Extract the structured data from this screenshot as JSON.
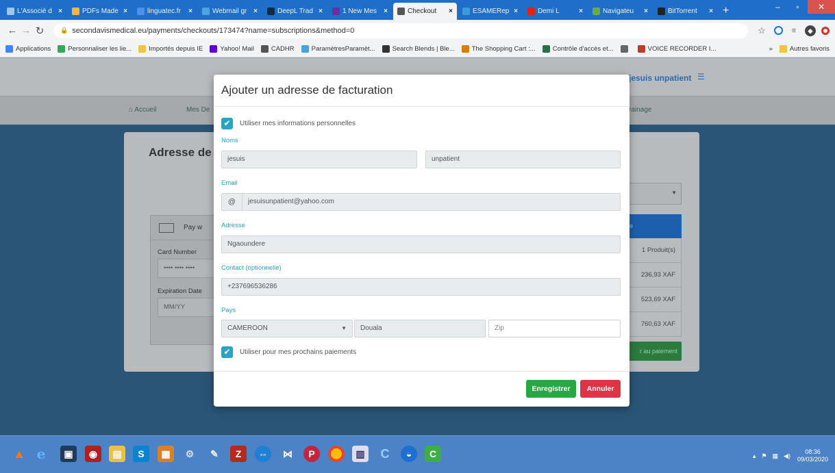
{
  "browser": {
    "tabs": [
      {
        "title": "L'Associé d",
        "color": "#9ec4ef"
      },
      {
        "title": "PDFs Made",
        "color": "#f0b44c"
      },
      {
        "title": "linguatec.fr",
        "color": "#4f8fe8"
      },
      {
        "title": "Webmail gr",
        "color": "#4fa3e0"
      },
      {
        "title": "DeepL Trad",
        "color": "#0f2b46"
      },
      {
        "title": "1 New Mes",
        "color": "#6d2fa0"
      },
      {
        "title": "Checkout",
        "color": "#555555",
        "active": true
      },
      {
        "title": "ESAMERep",
        "color": "#3e9bd6"
      },
      {
        "title": "Demi L",
        "color": "#e0241b"
      },
      {
        "title": "Navigateu",
        "color": "#6aa84f"
      },
      {
        "title": "BitTorrent",
        "color": "#222222"
      }
    ],
    "new_tab": "+",
    "url": "secondavismedical.eu/payments/checkouts/173474?name=subscriptions&method=0",
    "bookmarks": [
      {
        "label": "Applications",
        "color": "#4285f4"
      },
      {
        "label": "Personnaliser les lie...",
        "color": "#34a853"
      },
      {
        "label": "Importés depuis IE",
        "color": "#f4c542"
      },
      {
        "label": "Yahoo! Mail",
        "color": "#6001d2"
      },
      {
        "label": "CADHR",
        "color": "#555555"
      },
      {
        "label": "ParamètresParamèt...",
        "color": "#4aa3df"
      },
      {
        "label": "Search Blends | Ble...",
        "color": "#333333"
      },
      {
        "label": "The Shopping Cart :...",
        "color": "#e07b00"
      },
      {
        "label": "Contrôle d'accès et...",
        "color": "#2c6e49"
      },
      {
        "label": "",
        "color": "#666666"
      },
      {
        "label": "VOICE RECORDER I...",
        "color": "#c0392b"
      }
    ],
    "other_bookmarks": "Autres favoris",
    "overflow": "»"
  },
  "site": {
    "username": "jesuis unpatient",
    "nav": [
      {
        "label": "Accueil"
      },
      {
        "label": "Mes De"
      },
      {
        "label": "rainage"
      }
    ]
  },
  "background": {
    "title": "Adresse de",
    "pay_with": "Pay w",
    "card_number_label": "Card Number",
    "card_number_value": "•••• •••• ••••",
    "expiration_label": "Expiration Date",
    "expiration_placeholder": "MM/YY",
    "summary_head": "de",
    "summary_rows": [
      "1 Produit(s)",
      "236,93 XAF",
      "523,69 XAF",
      "760,63 XAF"
    ],
    "pay_button": "r au paiement"
  },
  "modal": {
    "title": "Ajouter un adresse de facturation",
    "use_personal_info": "Utiliser mes informations personnelles",
    "labels": {
      "names": "Noms",
      "email": "Email",
      "address": "Adresse",
      "contact": "Contact (optionnelle)",
      "country": "Pays"
    },
    "first_name": "jesuis",
    "last_name": "unpatient",
    "email_prefix": "@",
    "email": "jesuisunpatient@yahoo.com",
    "address": "Ngaoundere",
    "contact": "+237696536286",
    "country": "CAMEROON",
    "city": "Douala",
    "zip_placeholder": "Zip",
    "use_for_next": "Utiliser pour mes prochains paiements",
    "save_button": "Enregistrer",
    "cancel_button": "Annuler"
  },
  "taskbar": {
    "time": "08:36",
    "date": "09/03/2020"
  },
  "colors": {
    "accent": "#2aa3c4",
    "save": "#28a745",
    "cancel": "#dc3545",
    "tab_bar": "#1f6ec9"
  }
}
